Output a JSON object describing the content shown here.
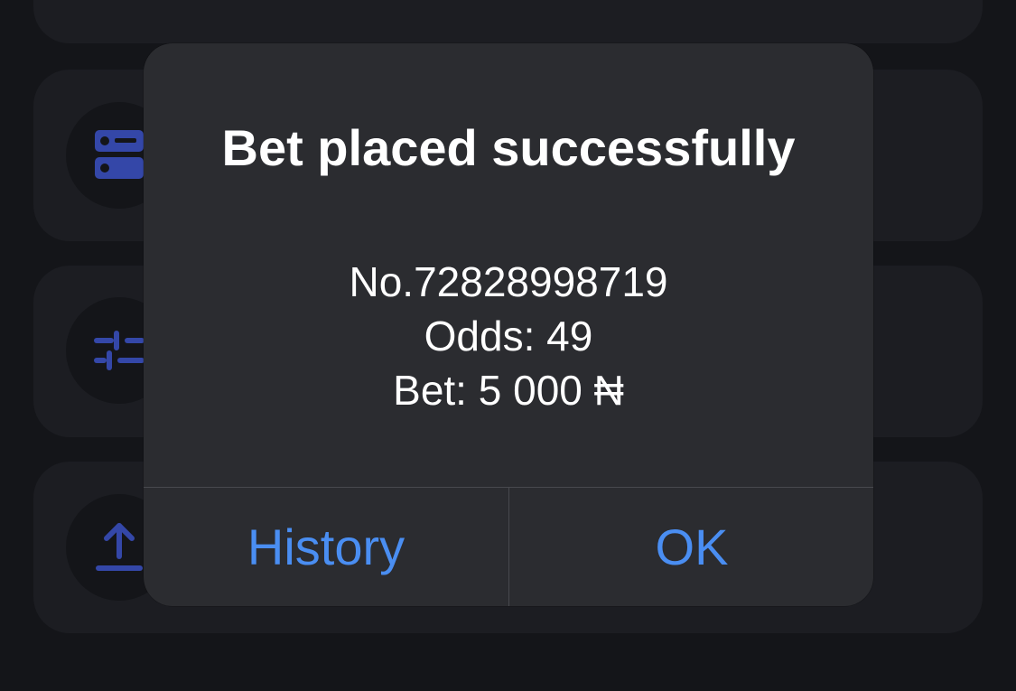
{
  "background": {
    "rows": [
      {
        "icon": "partial-icon"
      },
      {
        "icon": "server-icon"
      },
      {
        "icon": "sliders-icon"
      },
      {
        "icon": "upload-icon"
      }
    ]
  },
  "alert": {
    "title": "Bet placed successfully",
    "ticket": "No.72828998719",
    "odds": "Odds: 49",
    "bet": "Bet: 5 000 ₦",
    "buttons": {
      "history": "History",
      "ok": "OK"
    }
  },
  "colors": {
    "background": "#141519",
    "card": "#1c1d22",
    "alert": "#2b2c30",
    "accent": "#4a8ef2",
    "icon": "#3447a8"
  }
}
